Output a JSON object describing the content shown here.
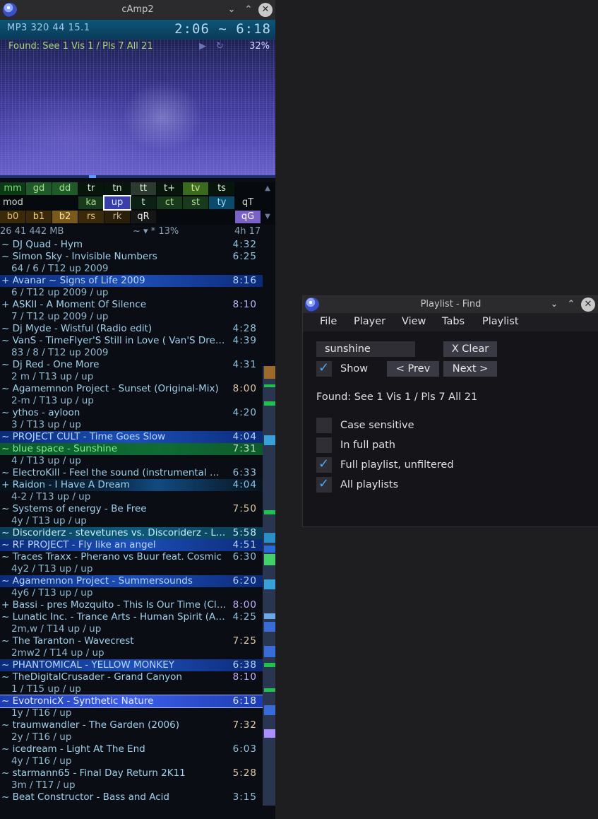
{
  "camp": {
    "title": "cAmp2",
    "format": "MP3 320 44  15.1",
    "time": "2:06  ~  6:18",
    "found": "Found: See  1 Vis  1 / Pls  7  All 21",
    "percent": "32%",
    "row1": [
      "mm",
      "gd",
      "dd",
      "tr",
      "tn",
      "tt",
      "t+",
      "tv",
      "ts"
    ],
    "row2": [
      "mod",
      "ka",
      "up",
      "t",
      "ct",
      "st",
      "ty",
      "qT"
    ],
    "row3": [
      "b0",
      "b1",
      "b2",
      "rs",
      "rk",
      "qR",
      "qG"
    ],
    "stats": {
      "left": "26  41  442 MB",
      "mid": "~ ▾ *  13%",
      "right": "4h 17"
    },
    "tracks": [
      {
        "t": "~ DJ Quad - Hym",
        "d": "4:32",
        "s": ""
      },
      {
        "t": "~ Simon Sky - Invisible Numbers",
        "d": "6:25",
        "s": ""
      },
      {
        "t": "64 / 6 / T12 up 2009",
        "d": "",
        "s": "info"
      },
      {
        "t": "+ Avanar ~ Signs of Life 2009",
        "d": "8:16",
        "s": "hl-blue"
      },
      {
        "t": "6 / T12 up 2009 / up",
        "d": "",
        "s": "info"
      },
      {
        "t": "+ ASKII - A Moment Of Silence",
        "d": "8:10",
        "s": "dur-purple"
      },
      {
        "t": "7 / T12 up 2009 / up",
        "d": "",
        "s": "info"
      },
      {
        "t": "~ Dj Myde - Wistful (Radio edit)",
        "d": "4:28",
        "s": ""
      },
      {
        "t": "~ VanS - TimeFlyer'S Still in Love ( Van'S Dream Mix )",
        "d": "4:39",
        "s": ""
      },
      {
        "t": "83 / 8 / T12 up 2009",
        "d": "",
        "s": "info"
      },
      {
        "t": "~ Dj Red - One More",
        "d": "4:31",
        "s": ""
      },
      {
        "t": "2 m / T13 up / up",
        "d": "",
        "s": "info"
      },
      {
        "t": "~ Agamemnon Project - Sunset (Original-Mix)",
        "d": "8:00",
        "s": "dur-gold"
      },
      {
        "t": "2-m / T13 up / up",
        "d": "",
        "s": "info"
      },
      {
        "t": "~ ythos - ayloon",
        "d": "4:20",
        "s": ""
      },
      {
        "t": "3 / T13 up / up",
        "d": "",
        "s": "info"
      },
      {
        "t": "~ PROJECT CULT - Time Goes Slow",
        "d": "4:04",
        "s": "hl-blue"
      },
      {
        "t": "~ blue space - Sunshine",
        "d": "7:31",
        "s": "hl-green"
      },
      {
        "t": "4 / T13 up / up",
        "d": "",
        "s": "info"
      },
      {
        "t": "~ ElectroKill - Feel the sound (instrumental mix)",
        "d": "6:33",
        "s": ""
      },
      {
        "t": "+ Raidon - I Have A Dream",
        "d": "4:04",
        "s": "glow"
      },
      {
        "t": "4-2 / T13 up / up",
        "d": "",
        "s": "info"
      },
      {
        "t": "~ Systems of energy - Be Free",
        "d": "7:50",
        "s": "dur-gold"
      },
      {
        "t": "4y / T13 up / up",
        "d": "",
        "s": "info"
      },
      {
        "t": "~ Discoriderz - stevetunes vs. Discoriderz - Love",
        "d": "5:58",
        "s": "hl-cyan"
      },
      {
        "t": "~ RF PROJECT - Fly like an angel",
        "d": "4:51",
        "s": "hl-blue"
      },
      {
        "t": "~ Traces Traxx - Pherano vs Buur feat. Cosmic",
        "d": "6:30",
        "s": ""
      },
      {
        "t": "4y2 / T13 up / up",
        "d": "",
        "s": "info"
      },
      {
        "t": "~ Agamemnon Project - Summersounds",
        "d": "6:20",
        "s": "hl-blue"
      },
      {
        "t": "4y6 / T13 up / up",
        "d": "",
        "s": "info"
      },
      {
        "t": "+ Bassi - pres Mozquito - This Is Our Time (Club Mix)",
        "d": "8:00",
        "s": "dur-purple"
      },
      {
        "t": "~ Lunatic Inc. - Trance Arts - Human Spirit (Album)",
        "d": "4:25",
        "s": ""
      },
      {
        "t": "2m,w / T14 up / up",
        "d": "",
        "s": "info"
      },
      {
        "t": "~ The Taranton - Wavecrest",
        "d": "7:25",
        "s": "dur-gold"
      },
      {
        "t": "2mw2 / T14 up / up",
        "d": "",
        "s": "info"
      },
      {
        "t": "~ PHANTOMICAL - YELLOW MONKEY",
        "d": "6:38",
        "s": "hl-blue"
      },
      {
        "t": "~ TheDigitalCrusader - Grand Canyon",
        "d": "8:10",
        "s": "dur-purple"
      },
      {
        "t": "1 / T15 up / up",
        "d": "",
        "s": "info"
      },
      {
        "t": "~ EvotronicX - Synthetic Nature",
        "d": "6:18",
        "s": "hl-sel"
      },
      {
        "t": "1y / T16 / up",
        "d": "",
        "s": "info"
      },
      {
        "t": "~ traumwandler - The Garden (2006)",
        "d": "7:32",
        "s": "dur-gold"
      },
      {
        "t": "2y / T16 / up",
        "d": "",
        "s": "info"
      },
      {
        "t": "~ icedream - Light At The End",
        "d": "6:03",
        "s": ""
      },
      {
        "t": "4y / T16 / up",
        "d": "",
        "s": "info"
      },
      {
        "t": "~ starmann65 - Final Day Return 2K11",
        "d": "5:28",
        "s": "dur-gold"
      },
      {
        "t": "3m / T17 / up",
        "d": "",
        "s": "info"
      },
      {
        "t": "~ Beat Constructor - Bass and Acid",
        "d": "3:15",
        "s": ""
      }
    ]
  },
  "dialog": {
    "title": "Playlist - Find",
    "menu": [
      "File",
      "Player",
      "View",
      "Tabs",
      "Playlist"
    ],
    "search_value": "sunshine",
    "clear_label": "X Clear",
    "show_label": "Show",
    "prev_label": "< Prev",
    "next_label": "Next >",
    "found": "Found: See 1 Vis 1 / Pls 7  All 21",
    "options": [
      {
        "label": "Case sensitive",
        "checked": false
      },
      {
        "label": "In full path",
        "checked": false
      },
      {
        "label": "Full playlist, unfiltered",
        "checked": true
      },
      {
        "label": "All playlists",
        "checked": true
      }
    ]
  },
  "colors": {
    "accent": "#4aa8ff",
    "selection": "#3c5ee8",
    "found_green": "#a6d86a"
  }
}
